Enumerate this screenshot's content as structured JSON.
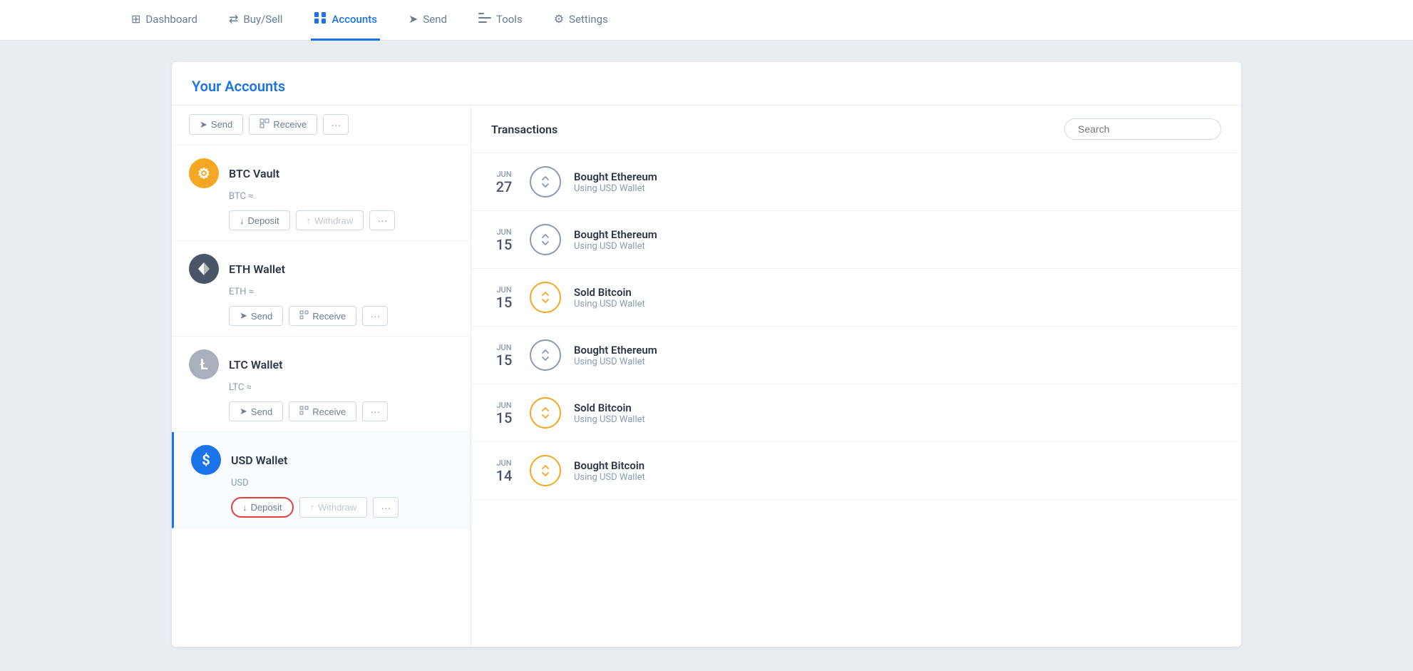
{
  "nav": {
    "items": [
      {
        "id": "dashboard",
        "label": "Dashboard",
        "icon": "⊞",
        "active": false
      },
      {
        "id": "buysell",
        "label": "Buy/Sell",
        "icon": "⇄",
        "active": false
      },
      {
        "id": "accounts",
        "label": "Accounts",
        "icon": "📋",
        "active": true
      },
      {
        "id": "send",
        "label": "Send",
        "icon": "➤",
        "active": false
      },
      {
        "id": "tools",
        "label": "Tools",
        "icon": "🗂",
        "active": false
      },
      {
        "id": "settings",
        "label": "Settings",
        "icon": "⚙",
        "active": false
      }
    ]
  },
  "sidebar": {
    "title": "Your Accounts",
    "accounts": [
      {
        "id": "btc-vault",
        "name": "BTC Vault",
        "currency": "BTC ≈",
        "iconType": "btc",
        "iconSymbol": "⚙",
        "active": false,
        "actions": [
          "Deposit",
          "Withdraw",
          "..."
        ]
      },
      {
        "id": "eth-wallet",
        "name": "ETH Wallet",
        "currency": "ETH ≈",
        "iconType": "eth",
        "iconSymbol": "⬡",
        "active": false,
        "actions": [
          "Send",
          "Receive",
          "..."
        ]
      },
      {
        "id": "ltc-wallet",
        "name": "LTC Wallet",
        "currency": "LTC ≈",
        "iconType": "ltc",
        "iconSymbol": "Ł",
        "active": false,
        "actions": [
          "Send",
          "Receive",
          "..."
        ]
      },
      {
        "id": "usd-wallet",
        "name": "USD Wallet",
        "currency": "USD",
        "iconType": "usd",
        "iconSymbol": "$",
        "active": true,
        "actions": [
          "Deposit",
          "Withdraw",
          "..."
        ]
      }
    ]
  },
  "transactions": {
    "title": "Transactions",
    "search_placeholder": "Search",
    "items": [
      {
        "month": "JUN",
        "day": "27",
        "title": "Bought Ethereum",
        "subtitle": "Using USD Wallet",
        "iconStyle": "normal"
      },
      {
        "month": "JUN",
        "day": "15",
        "title": "Bought Ethereum",
        "subtitle": "Using USD Wallet",
        "iconStyle": "normal"
      },
      {
        "month": "JUN",
        "day": "15",
        "title": "Sold Bitcoin",
        "subtitle": "Using USD Wallet",
        "iconStyle": "orange"
      },
      {
        "month": "JUN",
        "day": "15",
        "title": "Bought Ethereum",
        "subtitle": "Using USD Wallet",
        "iconStyle": "normal"
      },
      {
        "month": "JUN",
        "day": "15",
        "title": "Sold Bitcoin",
        "subtitle": "Using USD Wallet",
        "iconStyle": "orange"
      },
      {
        "month": "JUN",
        "day": "14",
        "title": "Bought Bitcoin",
        "subtitle": "Using USD Wallet",
        "iconStyle": "orange"
      }
    ]
  },
  "buttons": {
    "send": "Send",
    "receive": "Receive",
    "deposit": "Deposit",
    "withdraw": "Withdraw",
    "more": "···"
  }
}
